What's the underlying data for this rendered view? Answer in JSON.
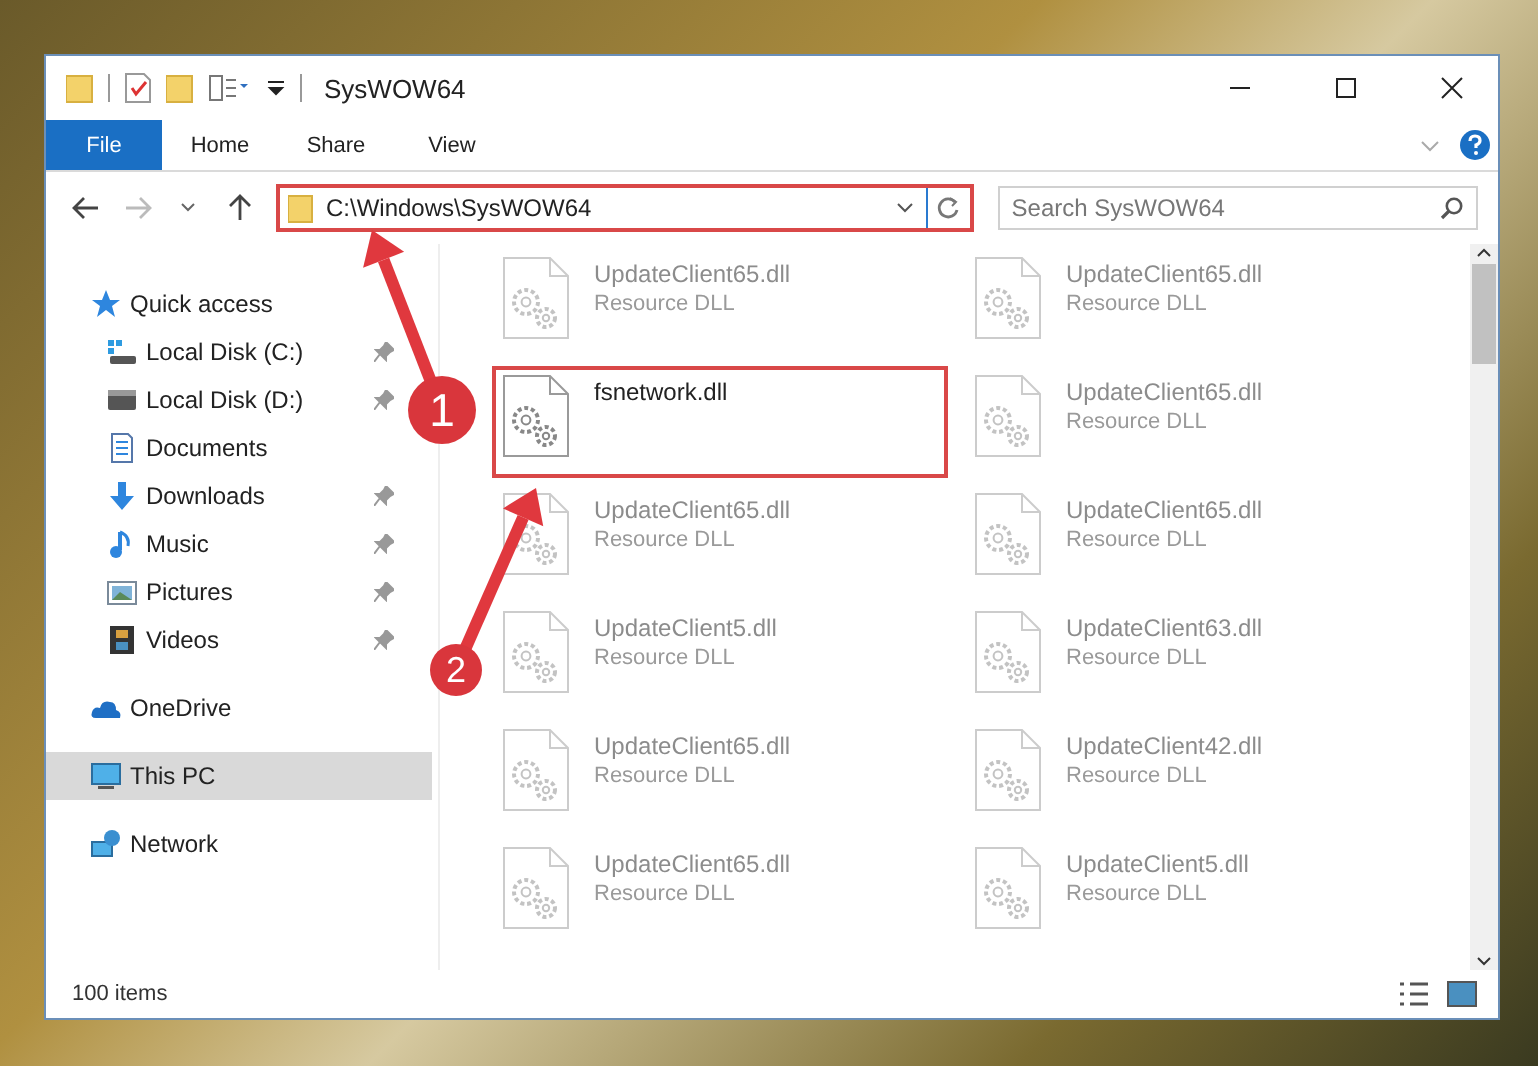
{
  "window": {
    "title": "SysWOW64"
  },
  "ribbon_tabs": [
    {
      "label": "File",
      "selected": true
    },
    {
      "label": "Home",
      "selected": false
    },
    {
      "label": "Share",
      "selected": false
    },
    {
      "label": "View",
      "selected": false
    }
  ],
  "address": {
    "value": "C:\\Windows\\SysWOW64"
  },
  "search": {
    "placeholder": "Search SysWOW64"
  },
  "sidebar": {
    "items": [
      {
        "label": "Quick access",
        "kind": "star",
        "selected": false,
        "children": [
          {
            "label": "Local Disk (C:)",
            "kind": "drive-win",
            "pinned": true,
            "selected": false
          },
          {
            "label": "Local Disk (D:)",
            "kind": "drive",
            "pinned": true,
            "selected": false
          },
          {
            "label": "Documents",
            "kind": "doc",
            "pinned": false,
            "selected": false
          },
          {
            "label": "Downloads",
            "kind": "download",
            "pinned": true,
            "selected": false
          },
          {
            "label": "Music",
            "kind": "music",
            "pinned": true,
            "selected": false
          },
          {
            "label": "Pictures",
            "kind": "picture",
            "pinned": true,
            "selected": false
          },
          {
            "label": "Videos",
            "kind": "video",
            "pinned": true,
            "selected": false
          }
        ]
      },
      {
        "label": "OneDrive",
        "kind": "cloud",
        "selected": false
      },
      {
        "label": "This PC",
        "kind": "pc",
        "selected": true
      },
      {
        "label": "Network",
        "kind": "network",
        "selected": false
      }
    ]
  },
  "files": [
    {
      "name": "UpdateClient65.dll",
      "type": "Resource DLL",
      "faded": true,
      "highlighted": false
    },
    {
      "name": "UpdateClient65.dll",
      "type": "Resource DLL",
      "faded": true,
      "highlighted": false
    },
    {
      "name": "fsnetwork.dll",
      "faded": false,
      "highlighted": true
    },
    {
      "name": "UpdateClient65.dll",
      "type": "Resource DLL",
      "faded": true,
      "highlighted": false
    },
    {
      "name": "UpdateClient65.dll",
      "type": "Resource DLL",
      "faded": true,
      "highlighted": false
    },
    {
      "name": "UpdateClient65.dll",
      "type": "Resource DLL",
      "faded": true,
      "highlighted": false
    },
    {
      "name": "UpdateClient5.dll",
      "type": "Resource DLL",
      "faded": true,
      "highlighted": false
    },
    {
      "name": "UpdateClient63.dll",
      "type": "Resource DLL",
      "faded": true,
      "highlighted": false
    },
    {
      "name": "UpdateClient65.dll",
      "type": "Resource DLL",
      "faded": true,
      "highlighted": false
    },
    {
      "name": "UpdateClient42.dll",
      "type": "Resource DLL",
      "faded": true,
      "highlighted": false
    },
    {
      "name": "UpdateClient65.dll",
      "type": "Resource DLL",
      "faded": true,
      "highlighted": false
    },
    {
      "name": "UpdateClient5.dll",
      "type": "Resource DLL",
      "faded": true,
      "highlighted": false
    }
  ],
  "status_bar": {
    "item_count": "100 items"
  },
  "annotations": [
    {
      "number": "1"
    },
    {
      "number": "2"
    }
  ]
}
